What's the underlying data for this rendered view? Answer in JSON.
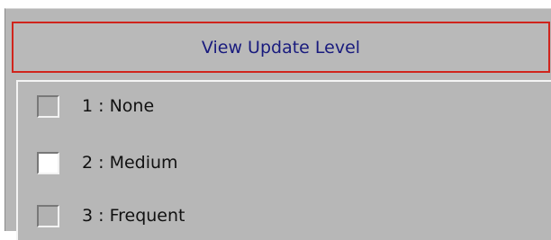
{
  "header": {
    "title": "View Update Level"
  },
  "options": [
    {
      "label": "1 : None",
      "checked": false
    },
    {
      "label": "2 : Medium",
      "checked": true
    },
    {
      "label": "3 : Frequent",
      "checked": false
    }
  ],
  "colors": {
    "header_text": "#191b7e",
    "header_border": "#d0241c",
    "panel_bg": "#b7b7b7",
    "checked_box": "#ffffff"
  }
}
